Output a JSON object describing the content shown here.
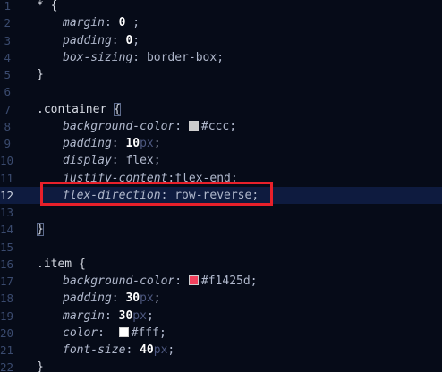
{
  "active_line": 12,
  "lines": [
    {
      "num": "1",
      "tokens": [
        {
          "t": "* {",
          "c": "t-sel"
        }
      ]
    },
    {
      "num": "2",
      "indent": 1,
      "tokens": [
        {
          "t": "margin",
          "c": "t-prop"
        },
        {
          "t": ": ",
          "c": "t-punct"
        },
        {
          "t": "0",
          "c": "t-num"
        },
        {
          "t": " ;",
          "c": "t-punct"
        }
      ]
    },
    {
      "num": "3",
      "indent": 1,
      "tokens": [
        {
          "t": "padding",
          "c": "t-prop"
        },
        {
          "t": ": ",
          "c": "t-punct"
        },
        {
          "t": "0",
          "c": "t-num"
        },
        {
          "t": ";",
          "c": "t-punct"
        }
      ]
    },
    {
      "num": "4",
      "indent": 1,
      "tokens": [
        {
          "t": "box-sizing",
          "c": "t-prop"
        },
        {
          "t": ": ",
          "c": "t-punct"
        },
        {
          "t": "border-box",
          "c": "t-val"
        },
        {
          "t": ";",
          "c": "t-punct"
        }
      ]
    },
    {
      "num": "5",
      "tokens": [
        {
          "t": "}",
          "c": "t-brace"
        }
      ]
    },
    {
      "num": "6",
      "tokens": []
    },
    {
      "num": "7",
      "tokens": [
        {
          "t": ".container ",
          "c": "t-sel"
        },
        {
          "t": "{",
          "c": "t-brace-match"
        }
      ]
    },
    {
      "num": "8",
      "indent": 1,
      "tokens": [
        {
          "t": "background-color",
          "c": "t-prop"
        },
        {
          "t": ": ",
          "c": "t-punct"
        },
        {
          "swatch": "#cccccc"
        },
        {
          "t": "#ccc",
          "c": "t-val"
        },
        {
          "t": ";",
          "c": "t-punct"
        }
      ]
    },
    {
      "num": "9",
      "indent": 1,
      "tokens": [
        {
          "t": "padding",
          "c": "t-prop"
        },
        {
          "t": ": ",
          "c": "t-punct"
        },
        {
          "t": "10",
          "c": "t-num"
        },
        {
          "t": "px",
          "c": "t-unit"
        },
        {
          "t": ";",
          "c": "t-punct"
        }
      ]
    },
    {
      "num": "10",
      "indent": 1,
      "tokens": [
        {
          "t": "display",
          "c": "t-prop"
        },
        {
          "t": ": ",
          "c": "t-punct"
        },
        {
          "t": "flex",
          "c": "t-val"
        },
        {
          "t": ";",
          "c": "t-punct"
        }
      ]
    },
    {
      "num": "11",
      "indent": 1,
      "tokens": [
        {
          "t": "justify-content",
          "c": "t-prop"
        },
        {
          "t": ":",
          "c": "t-punct"
        },
        {
          "t": "flex-end",
          "c": "t-val"
        },
        {
          "t": ";",
          "c": "t-punct"
        }
      ]
    },
    {
      "num": "12",
      "indent": 1,
      "tokens": [
        {
          "t": "flex-direction",
          "c": "t-prop"
        },
        {
          "t": ": ",
          "c": "t-punct"
        },
        {
          "t": "row-reverse",
          "c": "t-val"
        },
        {
          "t": ";",
          "c": "t-punct"
        }
      ]
    },
    {
      "num": "13",
      "tokens": []
    },
    {
      "num": "14",
      "tokens": [
        {
          "t": "}",
          "c": "t-brace-match"
        }
      ]
    },
    {
      "num": "15",
      "tokens": []
    },
    {
      "num": "16",
      "tokens": [
        {
          "t": ".item ",
          "c": "t-sel"
        },
        {
          "t": "{",
          "c": "t-brace"
        }
      ]
    },
    {
      "num": "17",
      "indent": 1,
      "tokens": [
        {
          "t": "background-color",
          "c": "t-prop"
        },
        {
          "t": ": ",
          "c": "t-punct"
        },
        {
          "swatch": "#f1425d"
        },
        {
          "t": "#f1425d",
          "c": "t-val"
        },
        {
          "t": ";",
          "c": "t-punct"
        }
      ]
    },
    {
      "num": "18",
      "indent": 1,
      "tokens": [
        {
          "t": "padding",
          "c": "t-prop"
        },
        {
          "t": ": ",
          "c": "t-punct"
        },
        {
          "t": "30",
          "c": "t-num"
        },
        {
          "t": "px",
          "c": "t-unit"
        },
        {
          "t": ";",
          "c": "t-punct"
        }
      ]
    },
    {
      "num": "19",
      "indent": 1,
      "tokens": [
        {
          "t": "margin",
          "c": "t-prop"
        },
        {
          "t": ": ",
          "c": "t-punct"
        },
        {
          "t": "30",
          "c": "t-num"
        },
        {
          "t": "px",
          "c": "t-unit"
        },
        {
          "t": ";",
          "c": "t-punct"
        }
      ]
    },
    {
      "num": "20",
      "indent": 1,
      "tokens": [
        {
          "t": "color",
          "c": "t-prop"
        },
        {
          "t": ":  ",
          "c": "t-punct"
        },
        {
          "swatch": "#ffffff"
        },
        {
          "t": "#fff",
          "c": "t-val"
        },
        {
          "t": ";",
          "c": "t-punct"
        }
      ]
    },
    {
      "num": "21",
      "indent": 1,
      "tokens": [
        {
          "t": "font-size",
          "c": "t-prop"
        },
        {
          "t": ": ",
          "c": "t-punct"
        },
        {
          "t": "40",
          "c": "t-num"
        },
        {
          "t": "px",
          "c": "t-unit"
        },
        {
          "t": ";",
          "c": "t-punct"
        }
      ]
    },
    {
      "num": "22",
      "tokens": [
        {
          "t": "}",
          "c": "t-brace"
        }
      ]
    }
  ],
  "annotation": {
    "color": "#e8202a",
    "target_line": 12
  }
}
